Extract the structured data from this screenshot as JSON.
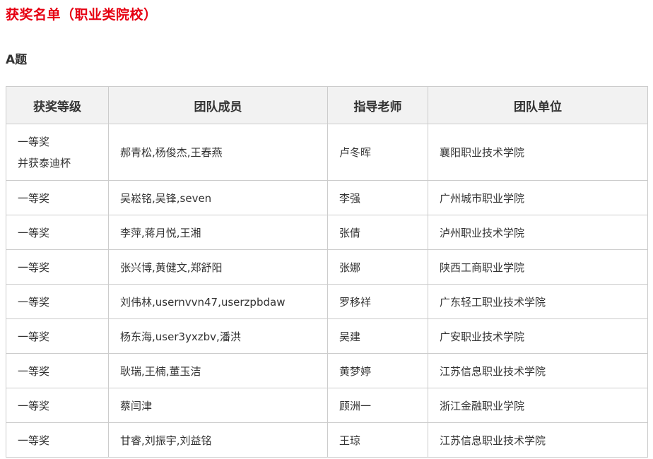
{
  "page": {
    "title": "获奖名单（职业类院校）",
    "section": "A题"
  },
  "table": {
    "headers": [
      "获奖等级",
      "团队成员",
      "指导老师",
      "团队单位"
    ],
    "rows": [
      {
        "award": [
          "一等奖",
          "并获泰迪杯"
        ],
        "members": "郝青松,杨俊杰,王春燕",
        "advisor": "卢冬晖",
        "unit": "襄阳职业技术学院"
      },
      {
        "award": [
          "一等奖"
        ],
        "members": "吴崧铭,吴锋,seven",
        "advisor": "李强",
        "unit": "广州城市职业学院"
      },
      {
        "award": [
          "一等奖"
        ],
        "members": "李萍,蒋月悦,王湘",
        "advisor": "张倩",
        "unit": "泸州职业技术学院"
      },
      {
        "award": [
          "一等奖"
        ],
        "members": "张兴博,黄健文,郑舒阳",
        "advisor": "张娜",
        "unit": "陕西工商职业学院"
      },
      {
        "award": [
          "一等奖"
        ],
        "members": "刘伟林,usernvvn47,userzpbdaw",
        "advisor": "罗移祥",
        "unit": "广东轻工职业技术学院"
      },
      {
        "award": [
          "一等奖"
        ],
        "members": "杨东海,user3yxzbv,潘洪",
        "advisor": "吴建",
        "unit": "广安职业技术学院"
      },
      {
        "award": [
          "一等奖"
        ],
        "members": "耿瑞,王楠,董玉洁",
        "advisor": "黄梦婷",
        "unit": "江苏信息职业技术学院"
      },
      {
        "award": [
          "一等奖"
        ],
        "members": "蔡闫津",
        "advisor": "顾洲一",
        "unit": "浙江金融职业学院"
      },
      {
        "award": [
          "一等奖"
        ],
        "members": "甘睿,刘振宇,刘益铭",
        "advisor": "王琼",
        "unit": "江苏信息职业技术学院"
      }
    ]
  },
  "colors": {
    "title": "#e60012",
    "header_bg": "#f2f2f2",
    "border": "#cccccc",
    "text": "#333333"
  }
}
